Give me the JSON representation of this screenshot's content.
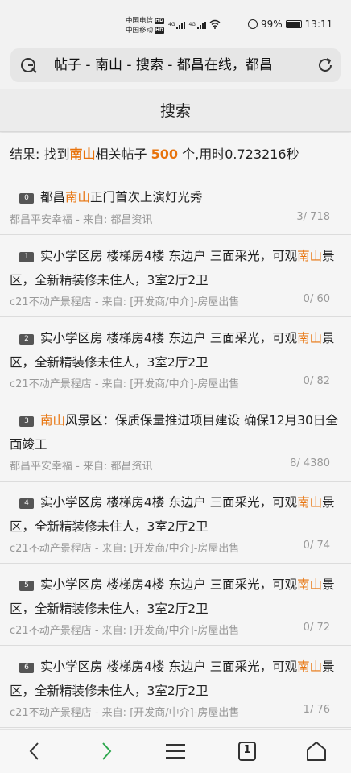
{
  "status": {
    "carrier1": "中国电信",
    "carrier2": "中国移动",
    "hd": "HD",
    "net": "4G",
    "battery": "99%",
    "time": "13:11"
  },
  "address": {
    "text": "帖子 - 南山 - 搜索 - 都昌在线，都昌"
  },
  "page_title": "搜索",
  "summary": {
    "prefix": "结果: 找到",
    "keyword": "南山",
    "middle": "相关帖子",
    "count": "500",
    "suffix": "个,用时0.723216秒"
  },
  "results": [
    {
      "index": "0",
      "title_before": "都昌",
      "title_highlight": "南山",
      "title_after": "正门首次上演灯光秀",
      "author": "都昌平安幸福",
      "from_label": "来自:",
      "source": "都昌资讯",
      "stats": "3/ 718"
    },
    {
      "index": "1",
      "title_before": "实小学区房 楼梯房4楼 东边户 三面采光，可观",
      "title_highlight": "南山",
      "title_after": "景区，全新精装修未住人，3室2厅2卫",
      "author": "c21不动产景程店",
      "from_label": "来自:",
      "source": "[开发商/中介]-房屋出售",
      "stats": "0/ 60"
    },
    {
      "index": "2",
      "title_before": "实小学区房 楼梯房4楼 东边户 三面采光，可观",
      "title_highlight": "南山",
      "title_after": "景区，全新精装修未住人，3室2厅2卫",
      "author": "c21不动产景程店",
      "from_label": "来自:",
      "source": "[开发商/中介]-房屋出售",
      "stats": "0/ 82"
    },
    {
      "index": "3",
      "title_before": "",
      "title_highlight": "南山",
      "title_after": "风景区：保质保量推进项目建设 确保12月30日全面竣工",
      "author": "都昌平安幸福",
      "from_label": "来自:",
      "source": "都昌资讯",
      "stats": "8/ 4380"
    },
    {
      "index": "4",
      "title_before": "实小学区房 楼梯房4楼 东边户 三面采光，可观",
      "title_highlight": "南山",
      "title_after": "景区，全新精装修未住人，3室2厅2卫",
      "author": "c21不动产景程店",
      "from_label": "来自:",
      "source": "[开发商/中介]-房屋出售",
      "stats": "0/ 74"
    },
    {
      "index": "5",
      "title_before": "实小学区房 楼梯房4楼 东边户 三面采光，可观",
      "title_highlight": "南山",
      "title_after": "景区，全新精装修未住人，3室2厅2卫",
      "author": "c21不动产景程店",
      "from_label": "来自:",
      "source": "[开发商/中介]-房屋出售",
      "stats": "0/ 72"
    },
    {
      "index": "6",
      "title_before": "实小学区房 楼梯房4楼 东边户 三面采光，可观",
      "title_highlight": "南山",
      "title_after": "景区，全新精装修未住人，3室2厅2卫",
      "author": "c21不动产景程店",
      "from_label": "来自:",
      "source": "[开发商/中介]-房屋出售",
      "stats": "1/ 76"
    }
  ],
  "colors": {
    "highlight": "#e8730c",
    "meta": "#999999",
    "forward_arrow": "#2fa84f"
  },
  "icons": {
    "address": "search-engine-icon",
    "reload": "reload-icon",
    "back": "chevron-left-icon",
    "forward": "chevron-right-icon",
    "menu": "menu-icon",
    "tabs": "tabs-icon",
    "home": "home-icon"
  },
  "tabs_count": "1"
}
